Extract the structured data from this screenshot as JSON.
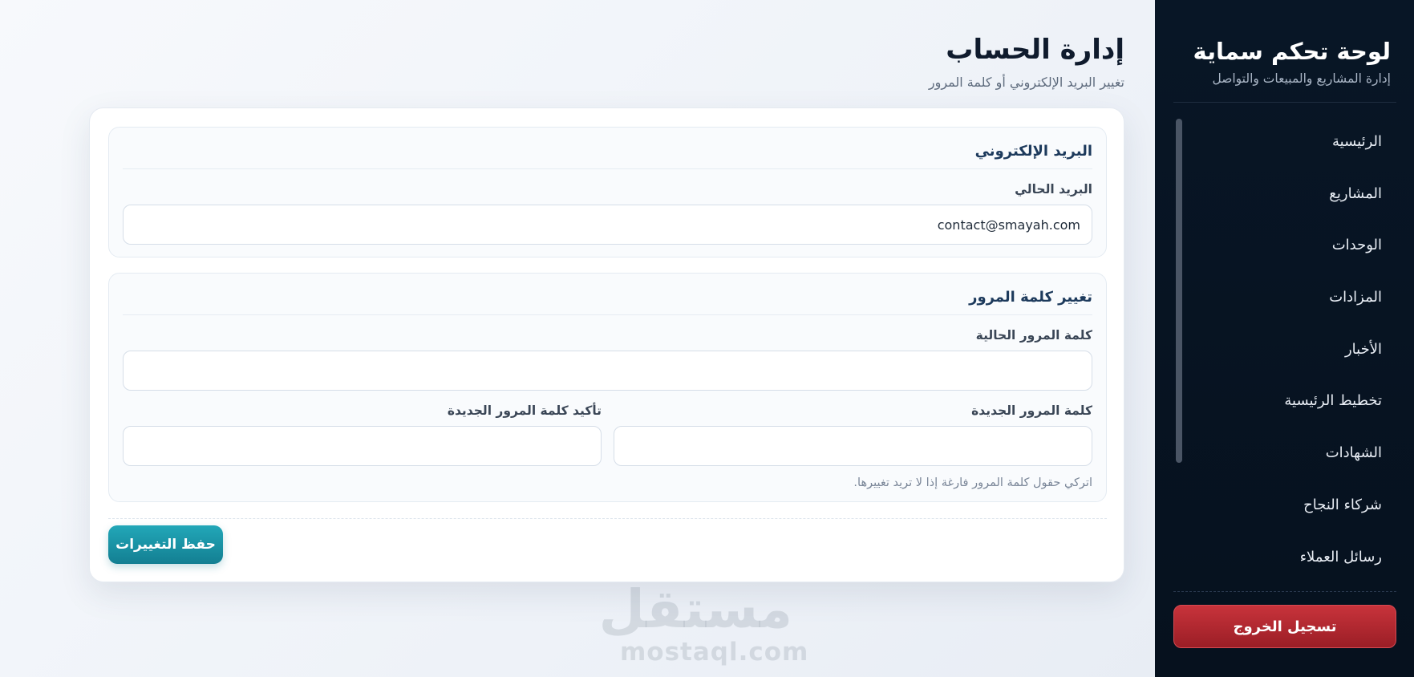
{
  "sidebar": {
    "title": "لوحة تحكم سماية",
    "subtitle": "إدارة المشاريع والمبيعات والتواصل",
    "nav": [
      {
        "label": "الرئيسية"
      },
      {
        "label": "المشاريع"
      },
      {
        "label": "الوحدات"
      },
      {
        "label": "المزادات"
      },
      {
        "label": "الأخبار"
      },
      {
        "label": "تخطيط الرئيسية"
      },
      {
        "label": "الشهادات"
      },
      {
        "label": "شركاء النجاح"
      },
      {
        "label": "رسائل العملاء"
      }
    ],
    "logout_label": "تسجيل الخروج",
    "colors": {
      "background": "#081626",
      "logout": "#b8282f"
    }
  },
  "header": {
    "title": "إدارة الحساب",
    "subtitle": "تغيير البريد الإلكتروني أو كلمة المرور"
  },
  "email_section": {
    "title": "البريد الإلكتروني",
    "current_email_label": "البريد الحالي",
    "current_email_value": "contact@smayah.com"
  },
  "password_section": {
    "title": "تغيير كلمة المرور",
    "current_password_label": "كلمة المرور الحالية",
    "current_password_value": "",
    "new_password_label": "كلمة المرور الجديدة",
    "new_password_value": "",
    "confirm_password_label": "تأكيد كلمة المرور الجديدة",
    "confirm_password_value": "",
    "hint": "اتركي حقول كلمة المرور فارغة إذا لا تريد تغييرها."
  },
  "actions": {
    "save_label": "حفظ التغييرات",
    "accent_color": "#1a96a8"
  },
  "watermark": {
    "arabic": "مستقل",
    "latin": "mostaql.com"
  }
}
